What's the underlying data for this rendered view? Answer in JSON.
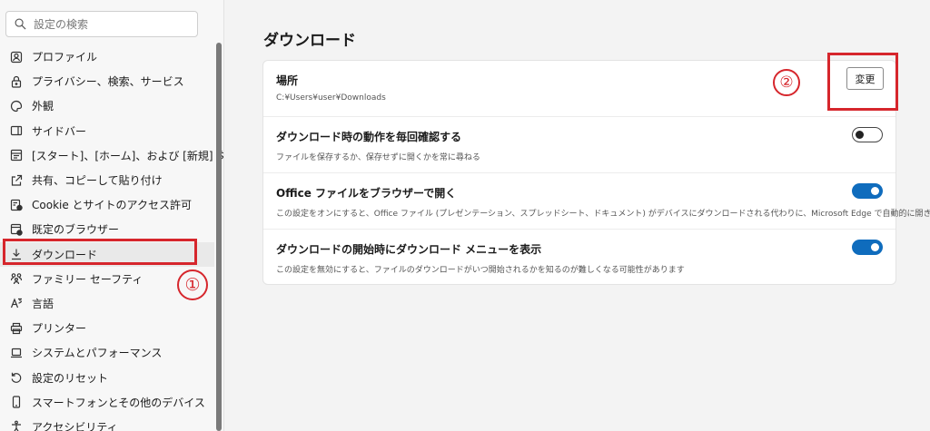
{
  "search": {
    "placeholder": "設定の検索"
  },
  "sidebar": {
    "items": [
      {
        "label": "プロファイル",
        "icon": "profile-icon"
      },
      {
        "label": "プライバシー、検索、サービス",
        "icon": "lock-icon"
      },
      {
        "label": "外観",
        "icon": "appearance-icon"
      },
      {
        "label": "サイドバー",
        "icon": "sidebar-icon"
      },
      {
        "label": "[スタート]、[ホーム]、および [新規] タブ",
        "icon": "start-page-icon"
      },
      {
        "label": "共有、コピーして貼り付け",
        "icon": "share-icon"
      },
      {
        "label": "Cookie とサイトのアクセス許可",
        "icon": "cookie-icon"
      },
      {
        "label": "既定のブラウザー",
        "icon": "default-browser-icon"
      },
      {
        "label": "ダウンロード",
        "icon": "download-icon",
        "active": true
      },
      {
        "label": "ファミリー セーフティ",
        "icon": "family-icon"
      },
      {
        "label": "言語",
        "icon": "language-icon"
      },
      {
        "label": "プリンター",
        "icon": "printer-icon"
      },
      {
        "label": "システムとパフォーマンス",
        "icon": "laptop-icon"
      },
      {
        "label": "設定のリセット",
        "icon": "reset-icon"
      },
      {
        "label": "スマートフォンとその他のデバイス",
        "icon": "phone-icon"
      },
      {
        "label": "アクセシビリティ",
        "icon": "accessibility-icon"
      }
    ]
  },
  "annotations": {
    "marker1": "①",
    "marker2": "②",
    "highlight_color": "#d6262c"
  },
  "main": {
    "title": "ダウンロード",
    "location": {
      "title": "場所",
      "path": "C:¥Users¥user¥Downloads",
      "button_label": "変更"
    },
    "settings": [
      {
        "title": "ダウンロード時の動作を毎回確認する",
        "desc": "ファイルを保存するか、保存せずに開くかを常に尋ねる",
        "enabled": false
      },
      {
        "title": "Office ファイルをブラウザーで開く",
        "desc": "この設定をオンにすると、Office ファイル (プレゼンテーション、スプレッドシート、ドキュメント) がデバイスにダウンロードされる代わりに、Microsoft Edge で自動的に開きます",
        "enabled": true
      },
      {
        "title": "ダウンロードの開始時にダウンロード メニューを表示",
        "desc": "この設定を無効にすると、ファイルのダウンロードがいつ開始されるかを知るのが難しくなる可能性があります",
        "enabled": true
      }
    ]
  },
  "colors": {
    "accent": "#0f6cbd"
  }
}
